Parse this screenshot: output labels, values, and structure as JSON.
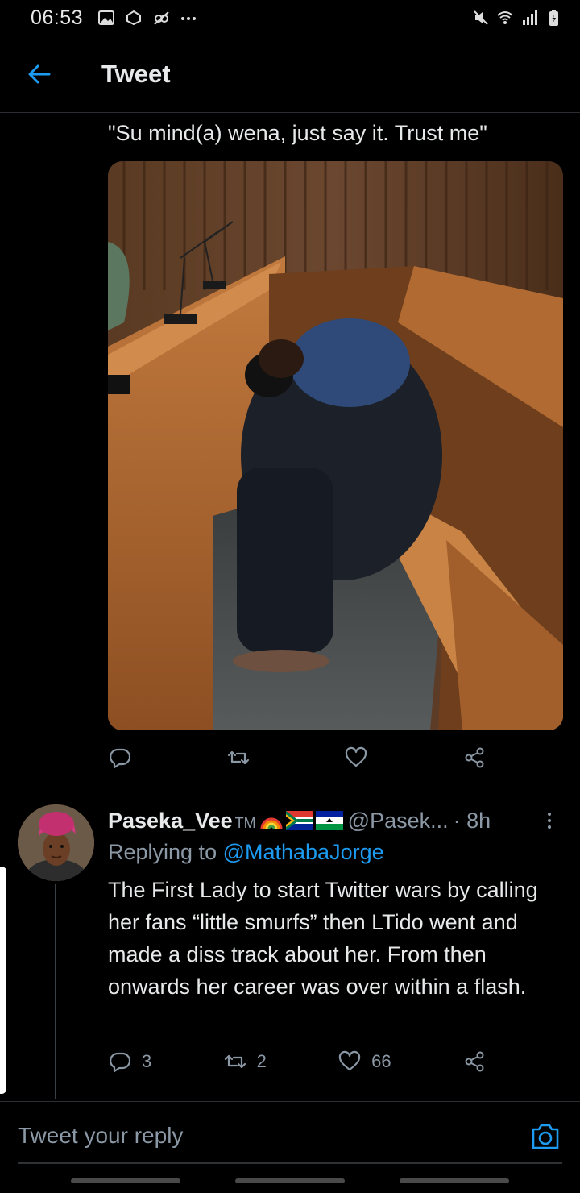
{
  "status_bar": {
    "time": "06:53",
    "left_icons": [
      "gallery-icon",
      "sync-icon",
      "no-sim-icon",
      "more-dots-icon"
    ],
    "right_icons": [
      "mute-icon",
      "wifi-icon",
      "signal-icon",
      "battery-icon"
    ]
  },
  "header": {
    "title": "Tweet",
    "back_icon": "arrow-left-icon"
  },
  "tweet": {
    "text": "\"Su mind(a) wena, just say it. Trust me\"",
    "actions": [
      "reply-icon",
      "retweet-icon",
      "like-icon",
      "share-icon"
    ]
  },
  "reply": {
    "display_name": "Paseka_Vee",
    "tm": "TM",
    "flags": [
      "rainbow-emoji",
      "south-africa-flag",
      "lesotho-flag"
    ],
    "handle": "@Pasek...",
    "time": "· 8h",
    "replying_to_prefix": "Replying to ",
    "replying_to_mention": "@MathabaJorge",
    "body": "The First Lady to start Twitter wars by calling her fans “little smurfs” then LTido went and made a diss track about her. From then onwards her career was over within a flash.",
    "counts": {
      "replies": "3",
      "retweets": "2",
      "likes": "66"
    }
  },
  "composer": {
    "placeholder": "Tweet your reply",
    "camera_icon": "camera-icon"
  },
  "colors": {
    "background": "#000000",
    "accent": "#1d9bf0",
    "muted": "#8b98a5",
    "text": "#e7e9ea"
  }
}
